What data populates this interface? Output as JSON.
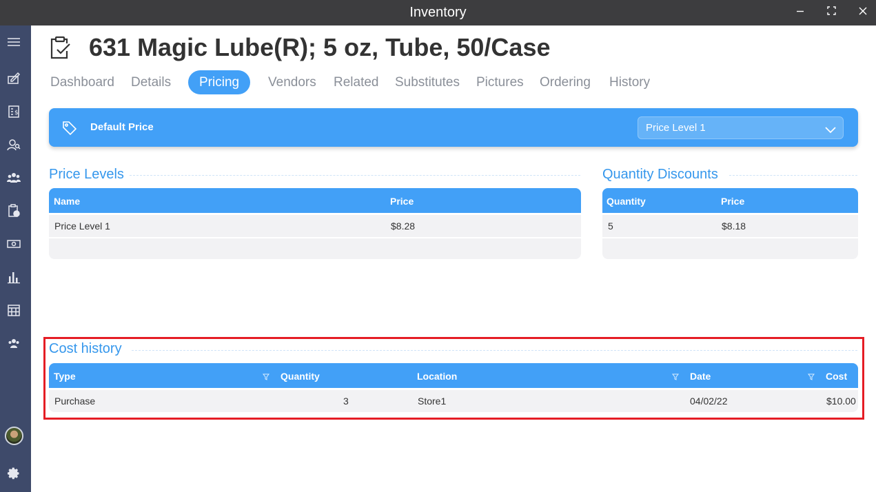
{
  "window": {
    "title": "Inventory"
  },
  "item": {
    "title": "631 Magic Lube(R); 5 oz, Tube, 50/Case"
  },
  "tabs": [
    "Dashboard",
    "Details",
    "Pricing",
    "Vendors",
    "Related",
    "Substitutes",
    "Pictures",
    "Ordering",
    "History"
  ],
  "default_price": {
    "label": "Default Price",
    "selected": "Price Level 1"
  },
  "price_levels": {
    "title": "Price Levels",
    "columns": [
      "Name",
      "Price"
    ],
    "rows": [
      {
        "name": "Price Level 1",
        "price": "$8.28"
      }
    ]
  },
  "quantity_discounts": {
    "title": "Quantity Discounts",
    "columns": [
      "Quantity",
      "Price"
    ],
    "rows": [
      {
        "quantity": "5",
        "price": "$8.18"
      }
    ]
  },
  "cost_history": {
    "title": "Cost history",
    "columns": [
      "Type",
      "Quantity",
      "Location",
      "Date",
      "Cost"
    ],
    "rows": [
      {
        "type": "Purchase",
        "quantity": "3",
        "location": "Store1",
        "date": "04/02/22",
        "cost": "$10.00"
      }
    ]
  },
  "colors": {
    "accent": "#42a0f7",
    "sidebar": "#3e4a6a",
    "titlebar": "#3d3d3f",
    "highlight": "#e51d25"
  }
}
